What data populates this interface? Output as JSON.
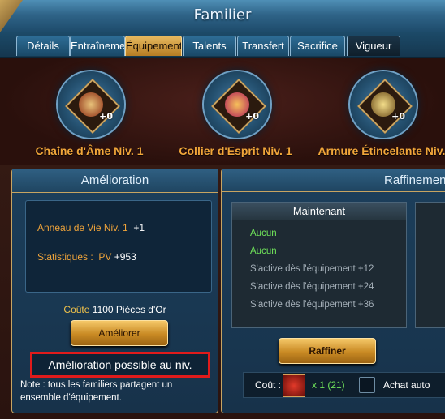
{
  "window": {
    "title": "Familier"
  },
  "tabs": [
    {
      "label": "Détails"
    },
    {
      "label": "Entraînement"
    },
    {
      "label": "Équipement"
    },
    {
      "label": "Talents"
    },
    {
      "label": "Transfert"
    },
    {
      "label": "Sacrifice"
    },
    {
      "label": "Vigueur"
    }
  ],
  "equipment": [
    {
      "name": "Chaîne d'Âme Niv. 1",
      "level_badge": "+0",
      "icon": "amulet-chain-icon"
    },
    {
      "name": "Collier d'Esprit Niv. 1",
      "level_badge": "+0",
      "icon": "ring-necklace-icon"
    },
    {
      "name": "Armure Étincelante Niv.",
      "level_badge": "+0",
      "icon": "armor-icon"
    }
  ],
  "upgrade_panel": {
    "title": "Amélioration",
    "item_name": "Anneau de Vie Niv. 1",
    "item_bonus": "+1",
    "stats_label": "Statistiques :",
    "stat_name": "PV",
    "stat_value": "+953",
    "cost_label": "Coûte",
    "cost_amount": "1100 Pièces d'Or",
    "button_label": "Améliorer",
    "message": "Amélioration possible au niv.",
    "note": "Note : tous les familiers partagent un ensemble d'équipement."
  },
  "refine_panel": {
    "title": "Raffinement",
    "current_header": "Maintenant",
    "lines": [
      {
        "text": "Aucun",
        "status": "active"
      },
      {
        "text": "Aucun",
        "status": "active"
      },
      {
        "text": "S'active dès l'équipement +12",
        "status": "locked"
      },
      {
        "text": "S'active dès l'équipement +24",
        "status": "locked"
      },
      {
        "text": "S'active dès l'équipement +36",
        "status": "locked"
      }
    ],
    "button_label": "Raffiner",
    "cost_label": "Coût :",
    "cost_qty": "x 1 (21)",
    "auto_buy_label": "Achat auto"
  },
  "colors": {
    "accent_gold": "#f1a63a",
    "active_green": "#6fe25a",
    "alert_red": "#e01b1b"
  }
}
